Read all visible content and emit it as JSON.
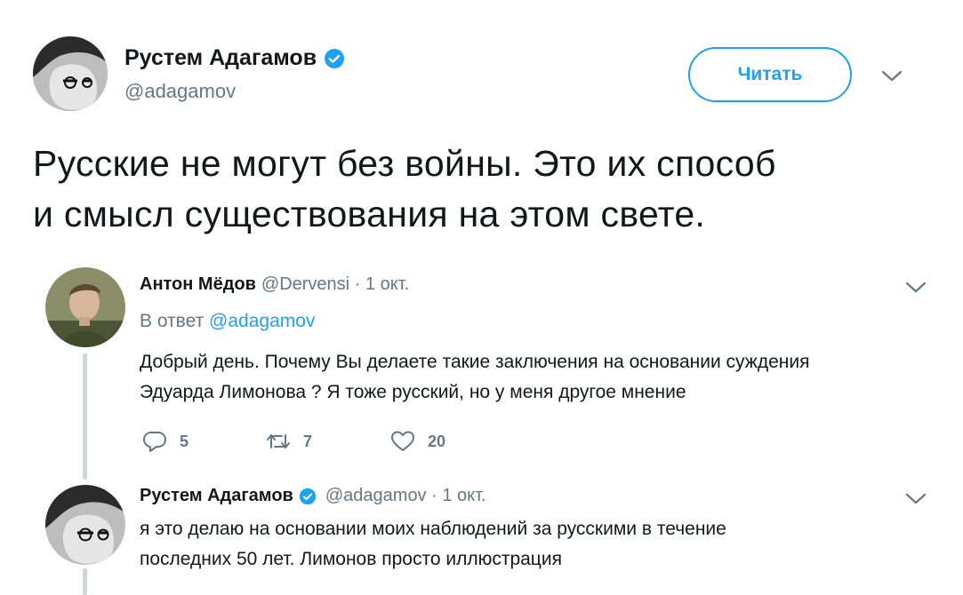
{
  "main_tweet": {
    "author_name": "Рустем Адагамов",
    "author_handle": "@adagamov",
    "follow_label": "Читать",
    "text_line1": "Русские не могут без войны. Это их способ",
    "text_line2": "и смысл существования на этом свете."
  },
  "replies": [
    {
      "author_name": "Антон Мёдов",
      "meta": "@Dervensi · 1 окт.",
      "reply_to_prefix": "В ответ",
      "reply_to_handle": "@adagamov",
      "text_line1": "Добрый день.  Почему Вы делаете такие заключения на основании суждения",
      "text_line2": "Эдуарда Лимонова ? Я тоже русский, но у меня другое мнение",
      "reply_count": "5",
      "retweet_count": "7",
      "like_count": "20"
    },
    {
      "author_name": "Рустем Адагамов",
      "meta": "@adagamov · 1 окт.",
      "text_line1": "я это делаю на основании моих наблюдений за русскими в течение",
      "text_line2": "последних 50 лет. Лимонов просто иллюстрация"
    }
  ],
  "colors": {
    "accent": "#1da1f2",
    "secondary_text": "#657786",
    "thread_line": "#ccd6dd"
  },
  "icons": [
    "verified-badge-icon",
    "chevron-down-icon",
    "reply-icon",
    "retweet-icon",
    "like-icon"
  ]
}
